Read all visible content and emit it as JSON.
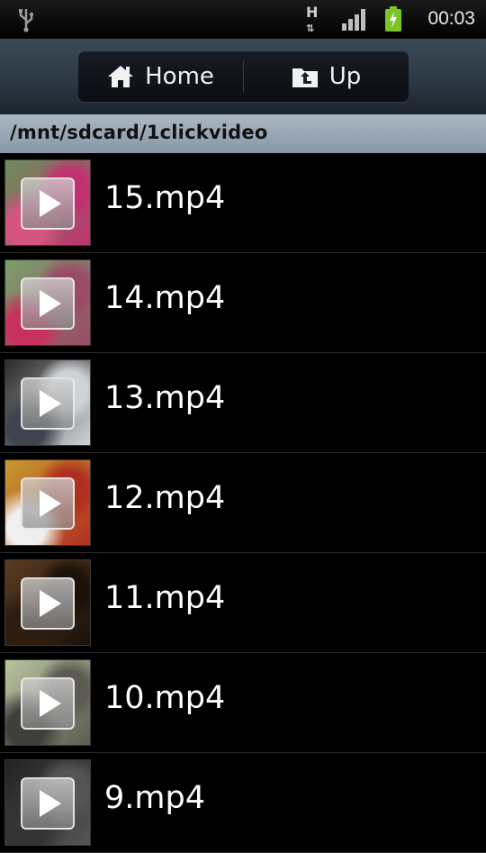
{
  "status_bar": {
    "time": "00:03",
    "network_type": "H",
    "icons": [
      "usb-icon",
      "hsdpa-icon",
      "signal-icon",
      "battery-charging-icon"
    ],
    "colors": {
      "battery": "#7bc52a"
    }
  },
  "toolbar": {
    "home_label": "Home",
    "up_label": "Up",
    "icons": [
      "home-icon",
      "folder-up-icon"
    ]
  },
  "path": "/mnt/sdcard/1clickvideo",
  "files": [
    {
      "name": "15.mp4",
      "thumb_colors": [
        "#6b8f5d",
        "#c1316f",
        "#d4547f"
      ]
    },
    {
      "name": "14.mp4",
      "thumb_colors": [
        "#7aa06a",
        "#9a4a66",
        "#c8305e"
      ]
    },
    {
      "name": "13.mp4",
      "thumb_colors": [
        "#2a2a2a",
        "#cfd3d8",
        "#3f4450"
      ]
    },
    {
      "name": "12.mp4",
      "thumb_colors": [
        "#c89a2e",
        "#b03020",
        "#f0f0f0"
      ]
    },
    {
      "name": "11.mp4",
      "thumb_colors": [
        "#5a3a22",
        "#1a120a",
        "#2d1c10"
      ]
    },
    {
      "name": "10.mp4",
      "thumb_colors": [
        "#b9c49f",
        "#5c5a52",
        "#3d3f3a"
      ]
    },
    {
      "name": "9.mp4",
      "thumb_colors": [
        "#222222",
        "#555555",
        "#333333"
      ]
    }
  ]
}
